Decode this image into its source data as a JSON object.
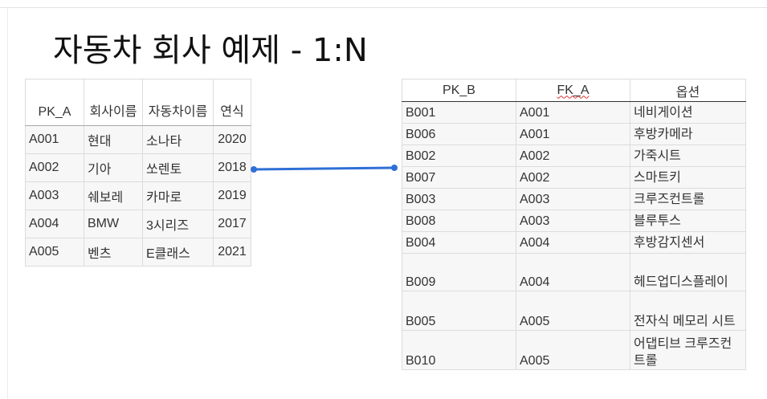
{
  "title": "자동차 회사 예제 - 1:N",
  "table_a": {
    "headers": [
      "PK_A",
      "회사이름",
      "자동차이름",
      "연식"
    ],
    "rows": [
      [
        "A001",
        "현대",
        "소나타",
        "2020"
      ],
      [
        "A002",
        "기아",
        "쏘렌토",
        "2018"
      ],
      [
        "A003",
        "쉐보레",
        "카마로",
        "2019"
      ],
      [
        "A004",
        "BMW",
        "3시리즈",
        "2017"
      ],
      [
        "A005",
        "벤츠",
        "E클래스",
        "2021"
      ]
    ]
  },
  "table_b": {
    "headers": [
      "PK_B",
      "FK_A",
      "옵션"
    ],
    "rows": [
      [
        "B001",
        "A001",
        "네비게이션"
      ],
      [
        "B006",
        "A001",
        "후방카메라"
      ],
      [
        "B002",
        "A002",
        "가죽시트"
      ],
      [
        "B007",
        "A002",
        "스마트키"
      ],
      [
        "B003",
        "A003",
        "크루즈컨트롤"
      ],
      [
        "B008",
        "A003",
        "블루투스"
      ],
      [
        "B004",
        "A004",
        "후방감지센서"
      ],
      [
        "B009",
        "A004",
        "헤드업디스플레이"
      ],
      [
        "B005",
        "A005",
        "전자식 메모리 시트"
      ],
      [
        "B010",
        "A005",
        "어댑티브 크루즈컨트롤"
      ]
    ]
  },
  "colors": {
    "connector": "#2f6fd6",
    "header_rule_b": "#333333",
    "grid": "#dcdcdc",
    "cell_bg": "#f7f7f7"
  }
}
